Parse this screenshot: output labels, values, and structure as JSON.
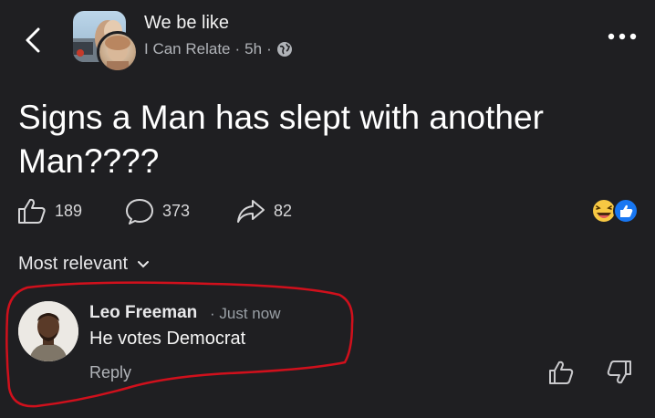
{
  "header": {
    "group_name": "We be like",
    "author": "I Can Relate",
    "time": "5h",
    "separator": "·"
  },
  "post": {
    "text": "Signs a Man has slept with another Man????"
  },
  "stats": {
    "likes": "189",
    "comments": "373",
    "shares": "82"
  },
  "comments_section": {
    "sort_label": "Most relevant"
  },
  "comment": {
    "author": "Leo Freeman",
    "time": "· Just now",
    "text": "He votes Democrat",
    "reply_label": "Reply"
  },
  "colors": {
    "background": "#1f1f22",
    "highlight_stroke": "#d0101c",
    "like_blue": "#1877f2",
    "haha_yellow": "#f7c843"
  },
  "icons": [
    "back-chevron-icon",
    "globe-icon",
    "more-dots-icon",
    "thumb-up-icon",
    "comment-bubble-icon",
    "share-arrow-icon",
    "haha-reaction-icon",
    "like-reaction-icon",
    "chevron-down-icon",
    "thumb-down-icon"
  ]
}
